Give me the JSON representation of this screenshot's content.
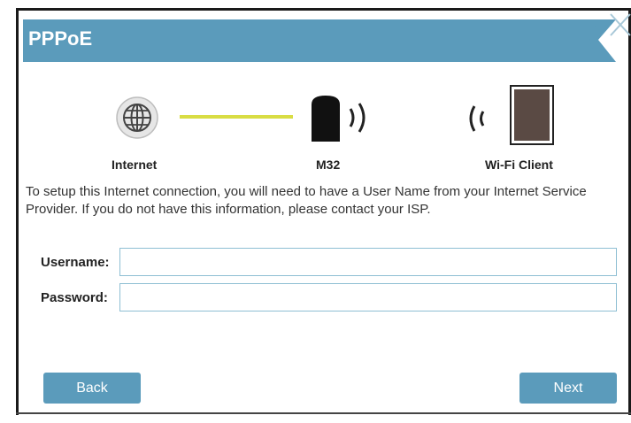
{
  "header": {
    "title": "PPPoE"
  },
  "illustration": {
    "internet_label": "Internet",
    "device_label": "M32",
    "client_label": "Wi-Fi Client",
    "colors": {
      "link_line": "#d9dd44",
      "device": "#111111",
      "tablet": "#5a4a44"
    }
  },
  "description": "To setup this Internet connection, you will need to have a User Name from your Internet Service Provider. If you do not have this information, please contact your ISP.",
  "form": {
    "username": {
      "label": "Username:",
      "value": "",
      "placeholder": ""
    },
    "password": {
      "label": "Password:",
      "value": "",
      "placeholder": ""
    }
  },
  "buttons": {
    "back": "Back",
    "next": "Next"
  },
  "icons": [
    "globe-icon",
    "router-icon",
    "wifi-signal-icon",
    "tablet-icon",
    "close-icon"
  ],
  "colors": {
    "accent": "#5b9bbb",
    "input_border": "#8ebfd3"
  }
}
